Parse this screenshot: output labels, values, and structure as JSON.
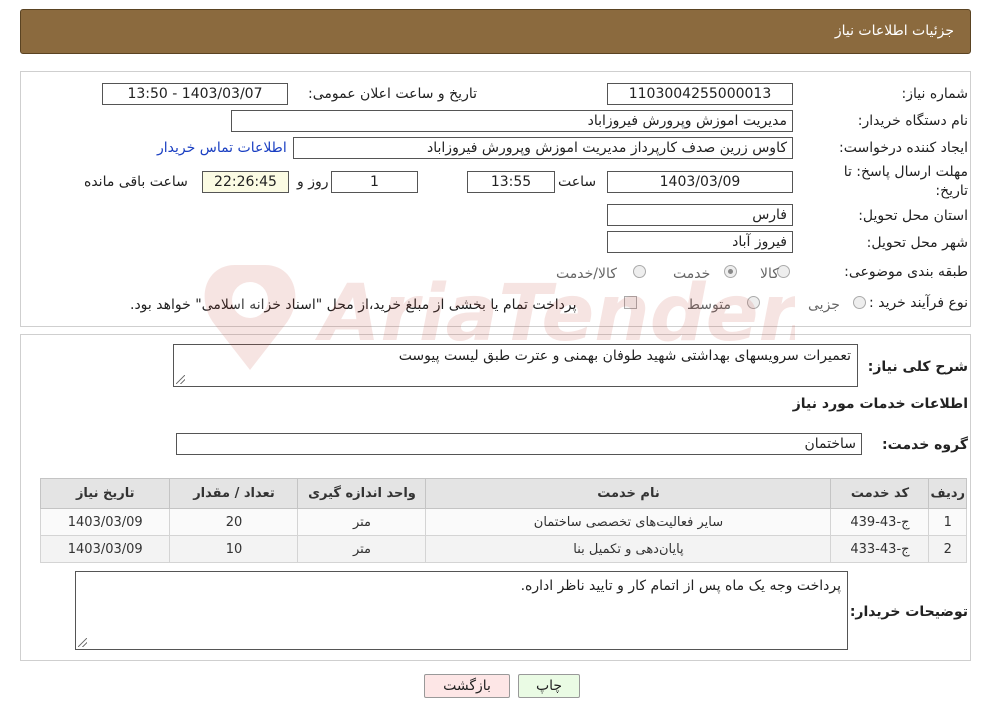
{
  "header": {
    "title": "جزئیات اطلاعات نیاز"
  },
  "form": {
    "need_number_label": "شماره نیاز:",
    "need_number": "1103004255000013",
    "announce_label": "تاریخ و ساعت اعلان عمومی:",
    "announce_value": "1403/03/07 - 13:50",
    "buyer_org_label": "نام دستگاه خریدار:",
    "buyer_org": "مدیریت اموزش وپرورش فیروزاباد",
    "creator_label": "ایجاد کننده درخواست:",
    "creator": "کاوس زرین صدف کارپرداز مدیریت اموزش وپرورش فیروزاباد",
    "contact_link": "اطلاعات تماس خریدار",
    "deadline_label_1": "مهلت ارسال پاسخ: تا",
    "deadline_label_2": "تاریخ:",
    "deadline_date": "1403/03/09",
    "time_label": "ساعت",
    "deadline_time": "13:55",
    "days_value": "1",
    "days_label": "روز و",
    "remaining_time": "22:26:45",
    "remaining_label": "ساعت باقی مانده",
    "province_label": "استان محل تحویل:",
    "province": "فارس",
    "city_label": "شهر محل تحویل:",
    "city": "فیروز آباد",
    "category_label": "طبقه بندی موضوعی:",
    "category_options": [
      "کالا",
      "خدمت",
      "کالا/خدمت"
    ],
    "category_selected": "خدمت",
    "process_label": "نوع فرآیند خرید :",
    "process_options": [
      "جزیی",
      "متوسط"
    ],
    "payment_note": "پرداخت تمام یا بخشی از مبلغ خرید،از محل \"اسناد خزانه اسلامی\" خواهد بود."
  },
  "details": {
    "summary_label": "شرح کلی نیاز:",
    "summary": "تعمیرات سرویسهای بهداشتی شهید طوفان بهمنی و عترت طبق لیست پیوست",
    "services_heading": "اطلاعات خدمات مورد نیاز",
    "group_label": "گروه خدمت:",
    "group_value": "ساختمان",
    "table_headers": [
      "ردیف",
      "کد خدمت",
      "نام خدمت",
      "واحد اندازه گیری",
      "تعداد / مقدار",
      "تاریخ نیاز"
    ],
    "rows": [
      [
        "1",
        "ج-43-439",
        "سایر فعالیت‌های تخصصی ساختمان",
        "متر",
        "20",
        "1403/03/09"
      ],
      [
        "2",
        "ج-43-433",
        "پایان‌دهی و تکمیل بنا",
        "متر",
        "10",
        "1403/03/09"
      ]
    ],
    "buyer_notes_label": "توضیحات خریدار:",
    "buyer_notes": "پرداخت وجه یک ماه پس از اتمام کار و تایید ناظر اداره."
  },
  "buttons": {
    "print": "چاپ",
    "back": "بازگشت"
  },
  "watermark_text": "AriaTender.neT",
  "colors": {
    "header_bg": "#8b6a3e",
    "link": "#1a3fc2"
  }
}
